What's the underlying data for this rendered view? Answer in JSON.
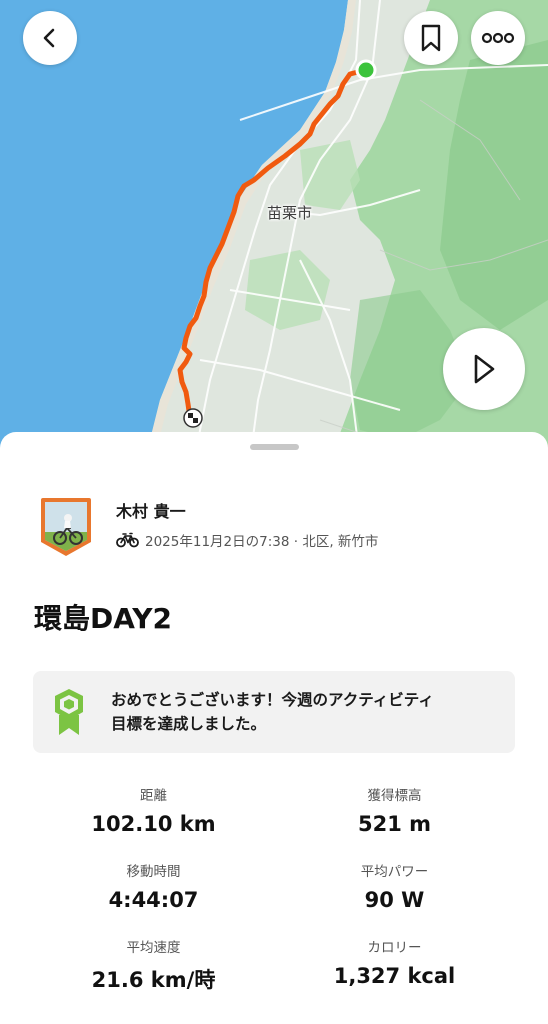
{
  "map": {
    "city_label": "苗栗市",
    "colors": {
      "sea": "#5fb0e6",
      "land": "#dfe6de",
      "green": "#9fd3a0",
      "route": "#f05a0f",
      "start": "#3cc33c"
    }
  },
  "controls": {
    "back_icon": "chevron-left-icon",
    "bookmark_icon": "bookmark-icon",
    "more_icon": "more-dots-icon",
    "play_icon": "play-icon"
  },
  "athlete": {
    "name": "木村 貴一",
    "activity_type_icon": "bike-icon",
    "meta": "2025年11月2日の7:38 · 北区, 新竹市"
  },
  "activity": {
    "title": "環島DAY2"
  },
  "banner": {
    "icon": "goal-badge-icon",
    "text_line1": "おめでとうございます！今週のアクティビティ",
    "text_line2": "目標を達成しました。"
  },
  "stats": [
    {
      "label": "距離",
      "value": "102.10 km"
    },
    {
      "label": "獲得標高",
      "value": "521 m"
    },
    {
      "label": "移動時間",
      "value": "4:44:07"
    },
    {
      "label": "平均パワー",
      "value": "90 W"
    },
    {
      "label": "平均速度",
      "value": "21.6 km/時"
    },
    {
      "label": "カロリー",
      "value": "1,327 kcal"
    }
  ]
}
